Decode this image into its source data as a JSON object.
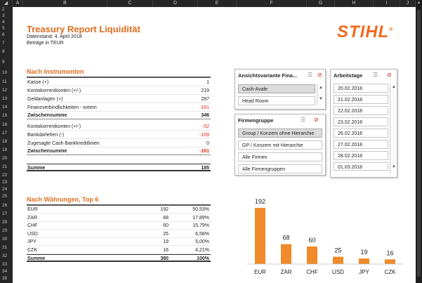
{
  "columns": [
    "A",
    "B",
    "C",
    "D",
    "E",
    "F",
    "G",
    "H",
    "I",
    "J"
  ],
  "rows": [
    "2",
    "3",
    "4",
    "5",
    "6",
    "7",
    "8",
    "9",
    "10",
    "11",
    "12",
    "13",
    "14",
    "15",
    "16",
    "17",
    "18",
    "19",
    "20",
    "21",
    "22",
    "23",
    "24",
    "25",
    "26",
    "27",
    "28",
    "29",
    "30",
    "31",
    "32",
    "33",
    "34",
    "35"
  ],
  "header": {
    "title": "Treasury Report Liquidität",
    "datenstand": "Datenstand: 4. April 2018",
    "betraege": "Beträge in TEUR",
    "logo": "STIHL",
    "logo_mark": "®"
  },
  "instrumente": {
    "title": "Nach Instrumenten",
    "rows": [
      {
        "label": "Kasse (+)",
        "value": "1"
      },
      {
        "label": "Kontokorrentkonten (+/-)",
        "value": "219"
      },
      {
        "label": "Geldanlagen (+)",
        "value": "287"
      },
      {
        "label": "Finanzverbindlichkeiten - extern",
        "value": "-161"
      },
      {
        "label": "Zwischensumme",
        "value": "346"
      },
      {
        "label": "Kontokorrentkonten (+/-)",
        "value": "-52"
      },
      {
        "label": "Bankdarlehen (-)",
        "value": "-109"
      },
      {
        "label": "Zugesagte Cash Bankkreditlinien",
        "value": "0"
      },
      {
        "label": "Zwischensumme",
        "value": "-161"
      },
      {
        "label": "Summe",
        "value": "185"
      }
    ]
  },
  "waehrungen": {
    "title": "Nach Währungen, Top 6",
    "rows": [
      {
        "cur": "EUR",
        "val": "192",
        "pct": "50,53%"
      },
      {
        "cur": "ZAR",
        "val": "68",
        "pct": "17,89%"
      },
      {
        "cur": "CHF",
        "val": "60",
        "pct": "15,79%"
      },
      {
        "cur": "USD",
        "val": "25",
        "pct": "6,58%"
      },
      {
        "cur": "JPY",
        "val": "19",
        "pct": "5,00%"
      },
      {
        "cur": "CZK",
        "val": "16",
        "pct": "4,21%"
      },
      {
        "cur": "Summe",
        "val": "380",
        "pct": "100%"
      }
    ]
  },
  "slicer_ansicht": {
    "title": "Ansichtsvariante Fina...",
    "items": [
      "Cash-Avale",
      "Head Room"
    ]
  },
  "slicer_firmen": {
    "title": "Firmengruppe",
    "items": [
      "Group / Konzem ohne Hierarchie",
      "GP / Konzem mit Hierarchie",
      "Alle Firmen",
      "Alle Firmengruppen"
    ]
  },
  "slicer_tage": {
    "title": "Arbeitstage",
    "items": [
      "20.02.2018",
      "21.02.2018",
      "22.02.2018",
      "23.02.2018",
      "26.02.2018",
      "27.02.2018",
      "28.02.2018",
      "01.03.2018"
    ]
  },
  "colors": {
    "accent": "#e06d1f",
    "bar": "#f08a2a",
    "negative": "#e02a1a"
  },
  "chart_data": {
    "type": "bar",
    "categories": [
      "EUR",
      "ZAR",
      "CHF",
      "USD",
      "JPY",
      "CZK"
    ],
    "values": [
      192,
      68,
      60,
      25,
      19,
      16
    ],
    "title": "",
    "xlabel": "",
    "ylabel": "",
    "ylim": [
      0,
      192
    ],
    "grid": false
  }
}
